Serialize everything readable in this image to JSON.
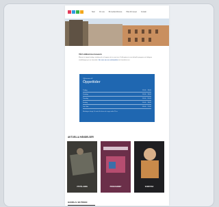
{
  "nav": {
    "logo_colors": [
      "#e23b5a",
      "#2f9be0",
      "#35b24a",
      "#f2a81d"
    ],
    "links": [
      "Start",
      "Om oss",
      "Bli medlem/Donera",
      "Hitta till museet",
      "Kontakt"
    ]
  },
  "intro": {
    "heading": "Vårt välkomna museum",
    "text": "Museet är öppet tisdag–söndag och vi hoppas att vi snart ses. Kolla gärna in vårt aktuella program och tidigare utställningar på vår hemsida. ",
    "link": "Läs mer om vår verksamhet",
    "tail": "och kontakta oss."
  },
  "hours": {
    "subtitle": "Välkommen till",
    "title": "Öppettider",
    "rows": [
      {
        "day": "Tisdag",
        "time": "11:00 – 18:00"
      },
      {
        "day": "Onsdag",
        "time": "11:00 – 18:00"
      },
      {
        "day": "Torsdag",
        "time": "11:00 – 20:00"
      },
      {
        "day": "Fredag",
        "time": "11:00 – 18:00"
      },
      {
        "day": "Lör–Sön",
        "time": "12:00 – 17:00"
      }
    ],
    "note": "Måndagar stängt. Fri entré för barn och unga under 20 år."
  },
  "events": {
    "heading": "AKTUELLA HÄNDELSER",
    "tiles": [
      {
        "label": "UTSTÄLLNING",
        "color": "#3b3a35",
        "accent": "#6a6a5e"
      },
      {
        "label": "PROGRAMMET",
        "color": "#6b2f49",
        "accent": "#b64d70"
      },
      {
        "label": "VERKSTAD",
        "color": "#1f1f22",
        "accent": "#c98a4a"
      }
    ]
  },
  "footer_heading": "HANDLA I BUTIKEN"
}
